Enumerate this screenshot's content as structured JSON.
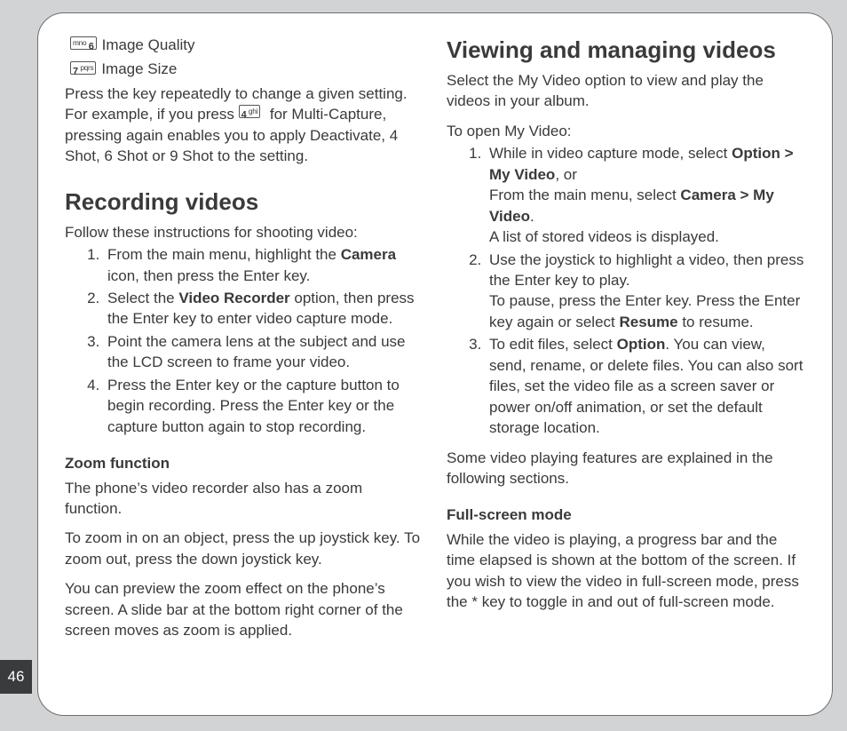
{
  "page_number": "46",
  "left": {
    "key6_label": " Image Quality",
    "key6_glyph": "mno 6",
    "key7_label": " Image Size",
    "key7_glyph": "7 pqrs",
    "key4_glyph": "4 ghi",
    "intro_a": "Press the key repeatedly to change a given setting. For example, if you press ",
    "intro_b": " for Multi-Capture, pressing again enables you to apply Deactivate, 4 Shot, 6 Shot or 9 Shot to the setting.",
    "h1": "Recording videos",
    "lead": "Follow these instructions for shooting video:",
    "li1_a": "From the main menu, highlight the ",
    "li1_b": "Camera",
    "li1_c": " icon, then press the Enter key.",
    "li2_a": "Select the ",
    "li2_b": "Video Recorder",
    "li2_c": " option, then press the Enter key to enter video capture mode.",
    "li3": "Point the camera lens at the subject and use the LCD screen to frame your video.",
    "li4": "Press the Enter key or the capture button to begin recording. Press the Enter key or the capture button again to stop recording.",
    "h2_zoom": "Zoom function",
    "zoom_p1": "The phone’s video recorder also has a zoom function.",
    "zoom_p2": "To zoom in on an object, press the up joystick key. To zoom out, press the down joystick key.",
    "zoom_p3": "You can preview the zoom effect on the phone’s screen. A slide bar at the bottom right corner of the screen moves as zoom is applied."
  },
  "right": {
    "h1": "Viewing and managing videos",
    "lead": "Select the My Video option to view and play the videos in your album.",
    "open_lead": "To open My Video:",
    "li1_a": "While in video capture mode, select ",
    "li1_b": "Option > My Video",
    "li1_c": ", or",
    "li1_d": "From the main menu, select ",
    "li1_e": "Camera > My Video",
    "li1_f": ".",
    "li1_g": "A list of stored videos is displayed.",
    "li2_a": "Use the joystick to highlight a video, then press the Enter key to play.",
    "li2_b": "To pause, press the Enter key. Press the Enter key again or select ",
    "li2_c": "Resume",
    "li2_d": " to resume.",
    "li3_a": "To edit files, select ",
    "li3_b": "Option",
    "li3_c": ". You can view, send, rename, or delete files. You can also sort files, set the video file as a screen saver or power on/off animation, or set the default storage location.",
    "after_list": "Some video playing features are explained in the following sections.",
    "h2_full": "Full-screen mode",
    "full_p": "While the video is playing, a progress bar and the time elapsed is shown at the bottom of the screen. If you wish to view the video in full-screen mode, press the * key to toggle in and out of full-screen mode."
  }
}
